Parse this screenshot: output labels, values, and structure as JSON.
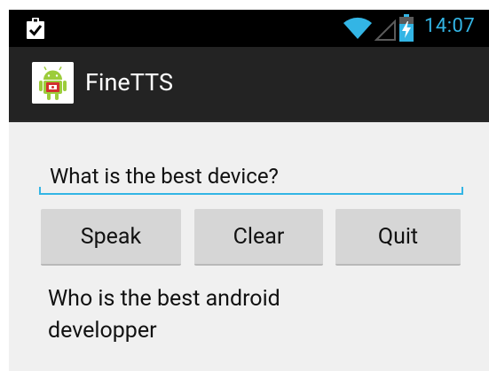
{
  "status_bar": {
    "time": "14:07",
    "icons": [
      "clipboard-check-icon",
      "wifi-icon",
      "signal-icon",
      "battery-charging-icon"
    ],
    "accent_color": "#33b5e5"
  },
  "action_bar": {
    "title": "FineTTS",
    "icon": "android-app-icon"
  },
  "main": {
    "input_value": "What is the best device?",
    "buttons": {
      "speak_label": "Speak",
      "clear_label": "Clear",
      "quit_label": "Quit"
    },
    "output_text": "Who is the best android developper"
  }
}
